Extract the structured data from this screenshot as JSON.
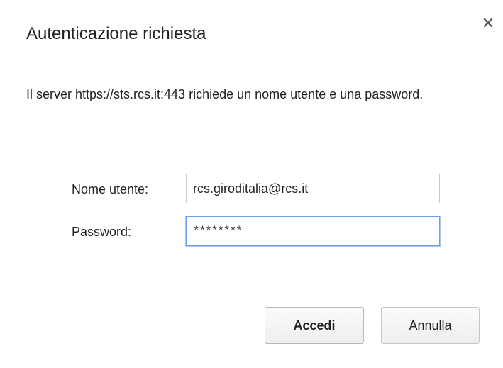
{
  "dialog": {
    "title": "Autenticazione richiesta",
    "close_icon": "close-icon",
    "message": "Il server https://sts.rcs.it:443 richiede un nome utente e una password."
  },
  "form": {
    "username_label": "Nome utente:",
    "username_value": "rcs.giroditalia@rcs.it",
    "password_label": "Password:",
    "password_value": "********"
  },
  "buttons": {
    "login_label": "Accedi",
    "cancel_label": "Annulla"
  },
  "colors": {
    "focus_border": "#6d9eeb",
    "text": "#222222",
    "background": "#ffffff"
  }
}
